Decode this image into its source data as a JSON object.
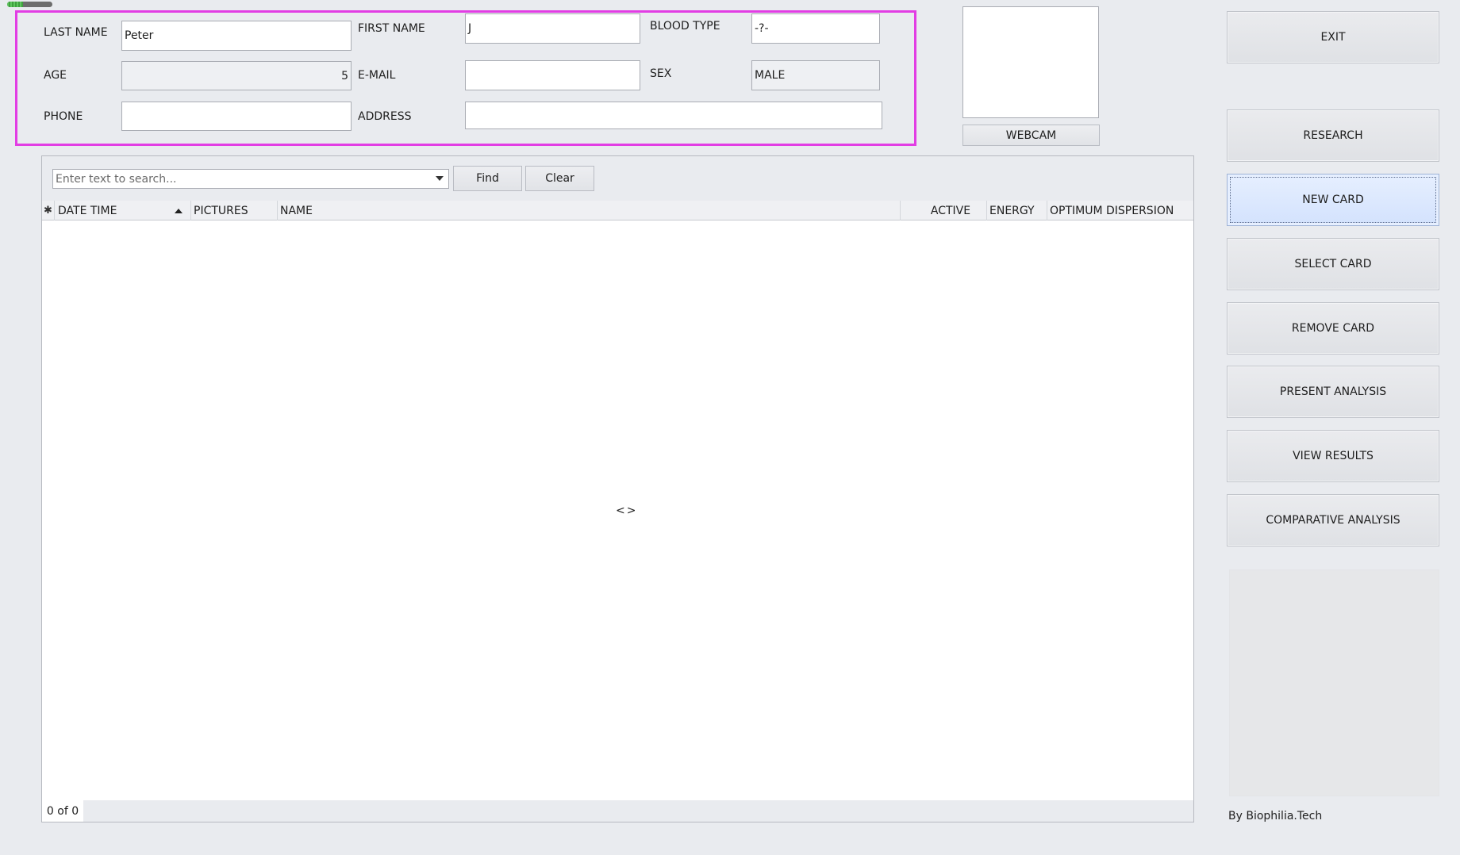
{
  "progress": {
    "value": 0.35
  },
  "patient": {
    "last_name_label": "LAST NAME",
    "last_name_value": "Peter",
    "first_name_label": "FIRST NAME",
    "first_name_value": "J",
    "blood_type_label": "BLOOD TYPE",
    "blood_type_value": "-?-",
    "age_label": "AGE",
    "age_value": "5",
    "email_label": "E-MAIL",
    "email_value": "",
    "sex_label": "SEX",
    "sex_value": "MALE",
    "phone_label": "PHONE",
    "phone_value": "",
    "address_label": "ADDRESS",
    "address_value": ""
  },
  "webcam": {
    "button_label": "WEBCAM"
  },
  "search": {
    "placeholder": "Enter text to search...",
    "find_label": "Find",
    "clear_label": "Clear"
  },
  "grid": {
    "columns": [
      "DATE TIME",
      "PICTURES",
      "NAME",
      "ACTIVE",
      "ENERGY",
      "OPTIMUM DISPERSION"
    ],
    "empty_text": "<>",
    "pager": "0 of 0"
  },
  "sidebar": {
    "exit": "EXIT",
    "research": "RESEARCH",
    "new_card": "NEW CARD",
    "select_card": "SELECT CARD",
    "remove_card": "REMOVE CARD",
    "present_analysis": "PRESENT ANALYSIS",
    "view_results": "VIEW RESULTS",
    "comparative_analysis": "COMPARATIVE ANALYSIS",
    "credit": "By Biophilia.Tech"
  },
  "colors": {
    "highlight_border": "#e23de4",
    "active_button": "#d3e2fd",
    "background": "#e9ebef"
  }
}
